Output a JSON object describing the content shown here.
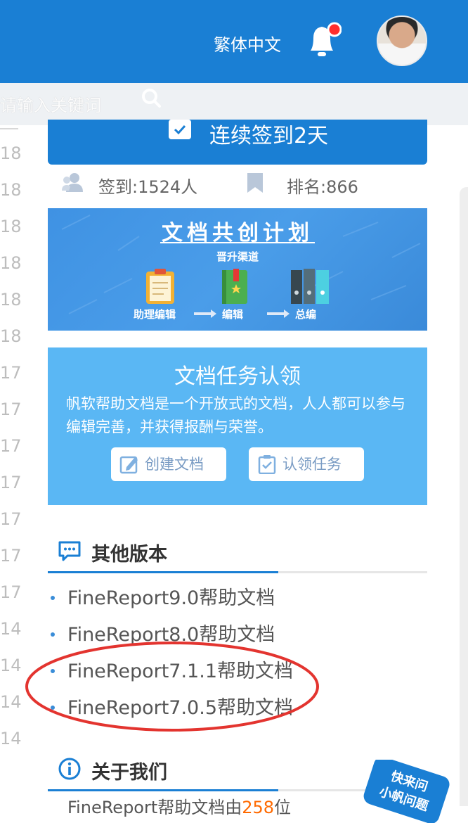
{
  "header": {
    "language_label": "繁体中文",
    "search_placeholder": "请输入关键词",
    "has_notification": true
  },
  "left_column": {
    "numbers": [
      "18",
      "18",
      "18",
      "18",
      "18",
      "18",
      "17",
      "17",
      "17",
      "17",
      "17",
      "17",
      "17",
      "14",
      "14",
      "14",
      "14"
    ]
  },
  "signin": {
    "button_label": "连续签到2天",
    "signin_count_label": "签到:1524人",
    "rank_label": "排名:866"
  },
  "banner_cocreate": {
    "title": "文档共创计划",
    "subtitle": "晋升渠道",
    "steps": [
      "助理编辑",
      "编辑",
      "总编"
    ]
  },
  "banner_task": {
    "title": "文档任务认领",
    "description": "帆软帮助文档是一个开放式的文档，人人都可以参与编辑完善，并获得报酬与荣誉。",
    "create_button": "创建文档",
    "claim_button": "认领任务"
  },
  "other_versions": {
    "title": "其他版本",
    "items": [
      "FineReport9.0帮助文档",
      "FineReport8.0帮助文档",
      "FineReport7.1.1帮助文档",
      "FineReport7.0.5帮助文档"
    ]
  },
  "about": {
    "title": "关于我们",
    "footer_text_start": "FineReport帮助文档由",
    "footer_highlight": "258",
    "footer_text_end": "位"
  },
  "sticker": {
    "line1": "快来问",
    "line2": "小帆问题"
  },
  "colors": {
    "brand_blue": "#1a7fd4",
    "banner_blue": "#5ab7f4",
    "highlight_red": "#e3342f",
    "notification_red": "#ff2d2d"
  }
}
